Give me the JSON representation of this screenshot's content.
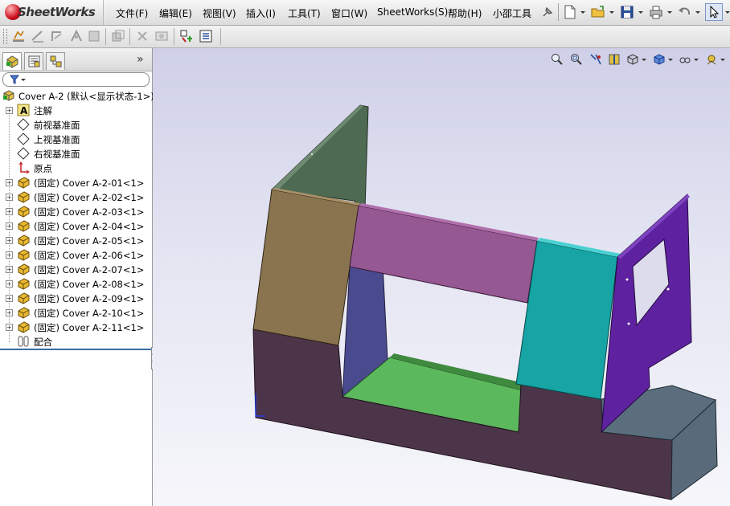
{
  "app": {
    "brand": "SheetWorks"
  },
  "menu": [
    {
      "label": "文件(F)"
    },
    {
      "label": "编辑(E)"
    },
    {
      "label": "视图(V)"
    },
    {
      "label": "插入(I)"
    },
    {
      "label": "工具(T)"
    },
    {
      "label": "窗口(W)"
    },
    {
      "label": "SheetWorks(S)"
    },
    {
      "label": "帮助(H)"
    },
    {
      "label": "小邵工具"
    }
  ],
  "toolbar_icons": [
    "pin-icon",
    "new-document-icon",
    "open-folder-icon",
    "save-icon",
    "print-icon",
    "undo-icon",
    "select-pointer-icon"
  ],
  "toolbar2_icons": [
    "feature-icon-1",
    "feature-icon-2",
    "feature-icon-3",
    "feature-icon-4",
    "feature-icon-5",
    "feature-icon-6",
    "feature-icon-7",
    "feature-icon-8",
    "feature-icon-9",
    "feature-icon-10"
  ],
  "panel": {
    "tabs": [
      "feature-manager-tab",
      "property-manager-tab",
      "configuration-manager-tab"
    ],
    "more": "»",
    "filter_icon": "filter-icon"
  },
  "tree": {
    "root": "Cover A-2  (默认<显示状态-1>)",
    "annotations": "注解",
    "planes": [
      "前视基准面",
      "上视基准面",
      "右视基准面"
    ],
    "origin": "原点",
    "components": [
      "(固定) Cover A-2-01<1>",
      "(固定) Cover A-2-02<1>",
      "(固定) Cover A-2-03<1>",
      "(固定) Cover A-2-04<1>",
      "(固定) Cover A-2-05<1>",
      "(固定) Cover A-2-06<1>",
      "(固定) Cover A-2-07<1>",
      "(固定) Cover A-2-08<1>",
      "(固定) Cover A-2-09<1>",
      "(固定) Cover A-2-10<1>",
      "(固定) Cover A-2-11<1>"
    ],
    "mates": "配合"
  },
  "view_tools": [
    "zoom-to-fit-icon",
    "zoom-to-area-icon",
    "previous-view-icon",
    "section-view-icon",
    "view-orientation-icon",
    "display-style-icon",
    "hide-show-icon",
    "appearance-icon"
  ],
  "colors": {
    "green_panel": "#4e6a52",
    "tan_panel": "#8a7450",
    "pink_panel": "#965892",
    "teal_panel": "#17a4a4",
    "purple_panel": "#5e22a0",
    "blue_inner": "#4a4a8e",
    "green_floor": "#5cb85c",
    "base_front": "#4c3549",
    "base_side": "#596a7a"
  }
}
